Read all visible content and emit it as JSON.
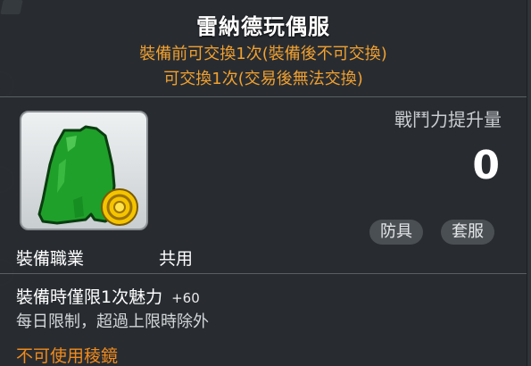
{
  "item": {
    "name": "雷納德玩偶服",
    "trade_note_1": "裝備前可交換1次(裝備後不可交換)",
    "trade_note_2": "可交換1次(交易後無法交換)",
    "icon": "green-plush-costume-icon",
    "badge_icon": "gold-coin-icon"
  },
  "power": {
    "label": "戰鬥力提升量",
    "value": "0"
  },
  "tags": {
    "armor": "防具",
    "outfit": "套服"
  },
  "job": {
    "label": "裝備職業",
    "value": "共用"
  },
  "stats": {
    "charm_label": "裝備時僅限1次魅力",
    "charm_amount": "+60",
    "daily_limit": "每日限制，超過上限時除外",
    "mirror_restriction": "不可使用稜鏡"
  },
  "colors": {
    "title": "#ffffff",
    "trade_note": "#f0a030",
    "warning": "#f08a1c",
    "panel": "#2c3034",
    "item_green": "#1fa02a",
    "coin_gold": "#f5c400"
  }
}
